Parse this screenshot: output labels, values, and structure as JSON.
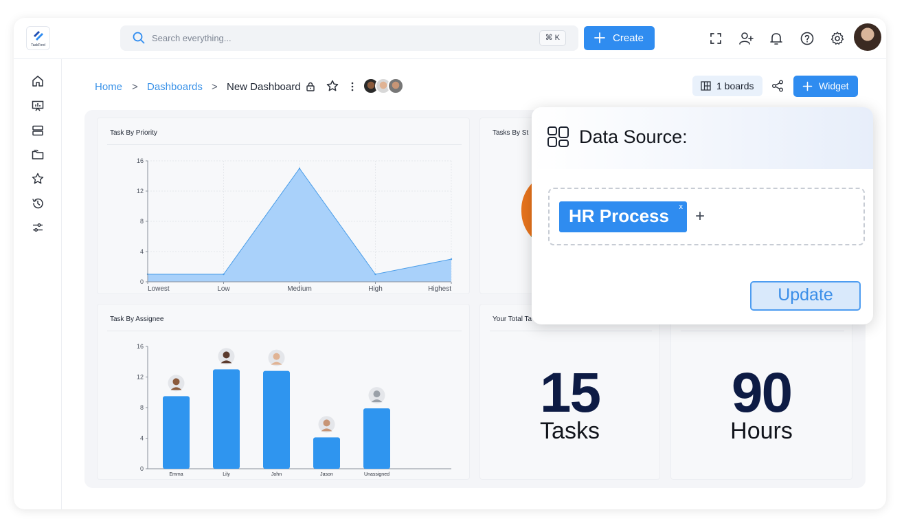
{
  "app": {
    "logo_text": "TaskFord"
  },
  "search": {
    "placeholder": "Search everything...",
    "shortcut": "⌘ K"
  },
  "header": {
    "create_label": "Create"
  },
  "breadcrumb": {
    "home": "Home",
    "dashboards": "Dashboards",
    "current": "New Dashboard",
    "separator": ">"
  },
  "toolbar": {
    "boards_label": "1 boards",
    "widget_label": "Widget"
  },
  "colors": {
    "accent": "#2f8cf0",
    "area_fill": "#a9d1fa",
    "area_stroke": "#4a9de8",
    "bar": "#2f95ef",
    "navy": "#0d1b44"
  },
  "icons": {
    "top": [
      "fullscreen-icon",
      "add-user-icon",
      "bell-icon",
      "help-icon",
      "gear-icon"
    ],
    "sidebar": [
      "home-icon",
      "presentation-icon",
      "server-icon",
      "folder-icon",
      "star-icon",
      "history-icon",
      "sliders-icon"
    ]
  },
  "cards": {
    "priority": {
      "title": "Task By Priority"
    },
    "status": {
      "title": "Tasks By St"
    },
    "assignee": {
      "title": "Task By Assignee"
    },
    "total": {
      "title": "Your Total Ta",
      "value": "15",
      "unit": "Tasks"
    },
    "hours": {
      "value": "90",
      "unit": "Hours"
    }
  },
  "popup": {
    "title": "Data Source:",
    "chip_label": "HR Process",
    "chip_remove": "x",
    "add_label": "+",
    "update_label": "Update"
  },
  "chart_data": [
    {
      "type": "area",
      "categories": [
        "Lowest",
        "Low",
        "Medium",
        "High",
        "Highest"
      ],
      "values": [
        1,
        1,
        15,
        1,
        3
      ],
      "ylim": [
        0,
        16
      ],
      "yticks": [
        0,
        4,
        8,
        12,
        16
      ],
      "grid": true
    },
    {
      "type": "bar",
      "categories": [
        "Emma",
        "Lily",
        "John",
        "Jason",
        "Unassigned"
      ],
      "values": [
        9.5,
        13,
        12.8,
        4.1,
        7.9
      ],
      "ylim": [
        0,
        16
      ],
      "yticks": [
        0,
        4,
        8,
        12,
        16
      ],
      "grid": false
    }
  ]
}
